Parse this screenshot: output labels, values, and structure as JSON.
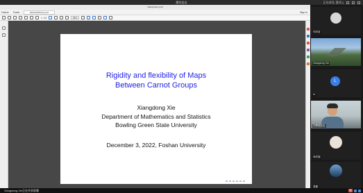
{
  "meeting": {
    "title": "腾讯会议",
    "status": "正在讲话: 惠鸿 ||"
  },
  "viewer": {
    "pdf_name": "slides(ration).pdf",
    "menu": [
      "Home",
      "Tools"
    ],
    "doc_tab": "20221203Xiexie.pdf",
    "signin": "Sign In",
    "page_indicator": "1 / 43",
    "zoom": "85%"
  },
  "slide": {
    "title_line1": "Rigidity and flexibility of Maps",
    "title_line2": "Between Carnot Groups",
    "author": "Xiangdong Xie",
    "department": "Department of Mathematics and Statistics",
    "university": "Bowling Green State University",
    "date": "December 3, 2022, Foshan University"
  },
  "participants": [
    {
      "name": "何凤谊",
      "type": "avatar",
      "color": "#d8d8d8"
    },
    {
      "name": "Xiangdong Xie",
      "type": "photo-mountain"
    },
    {
      "name": "liu",
      "type": "letter",
      "letter": "L",
      "color": "#3a7fe8"
    },
    {
      "name": "刘翠娟张弘",
      "type": "photo-person"
    },
    {
      "name": "尚欣翘",
      "type": "avatar",
      "color": "#e8e2d8"
    },
    {
      "name": "周樱",
      "type": "avatar",
      "color": "#2f5f8e"
    }
  ],
  "taskbar": {
    "sharing_text": "Xiangdong Xie正在共享屏幕",
    "ime_label": "中",
    "clock": "CH"
  }
}
